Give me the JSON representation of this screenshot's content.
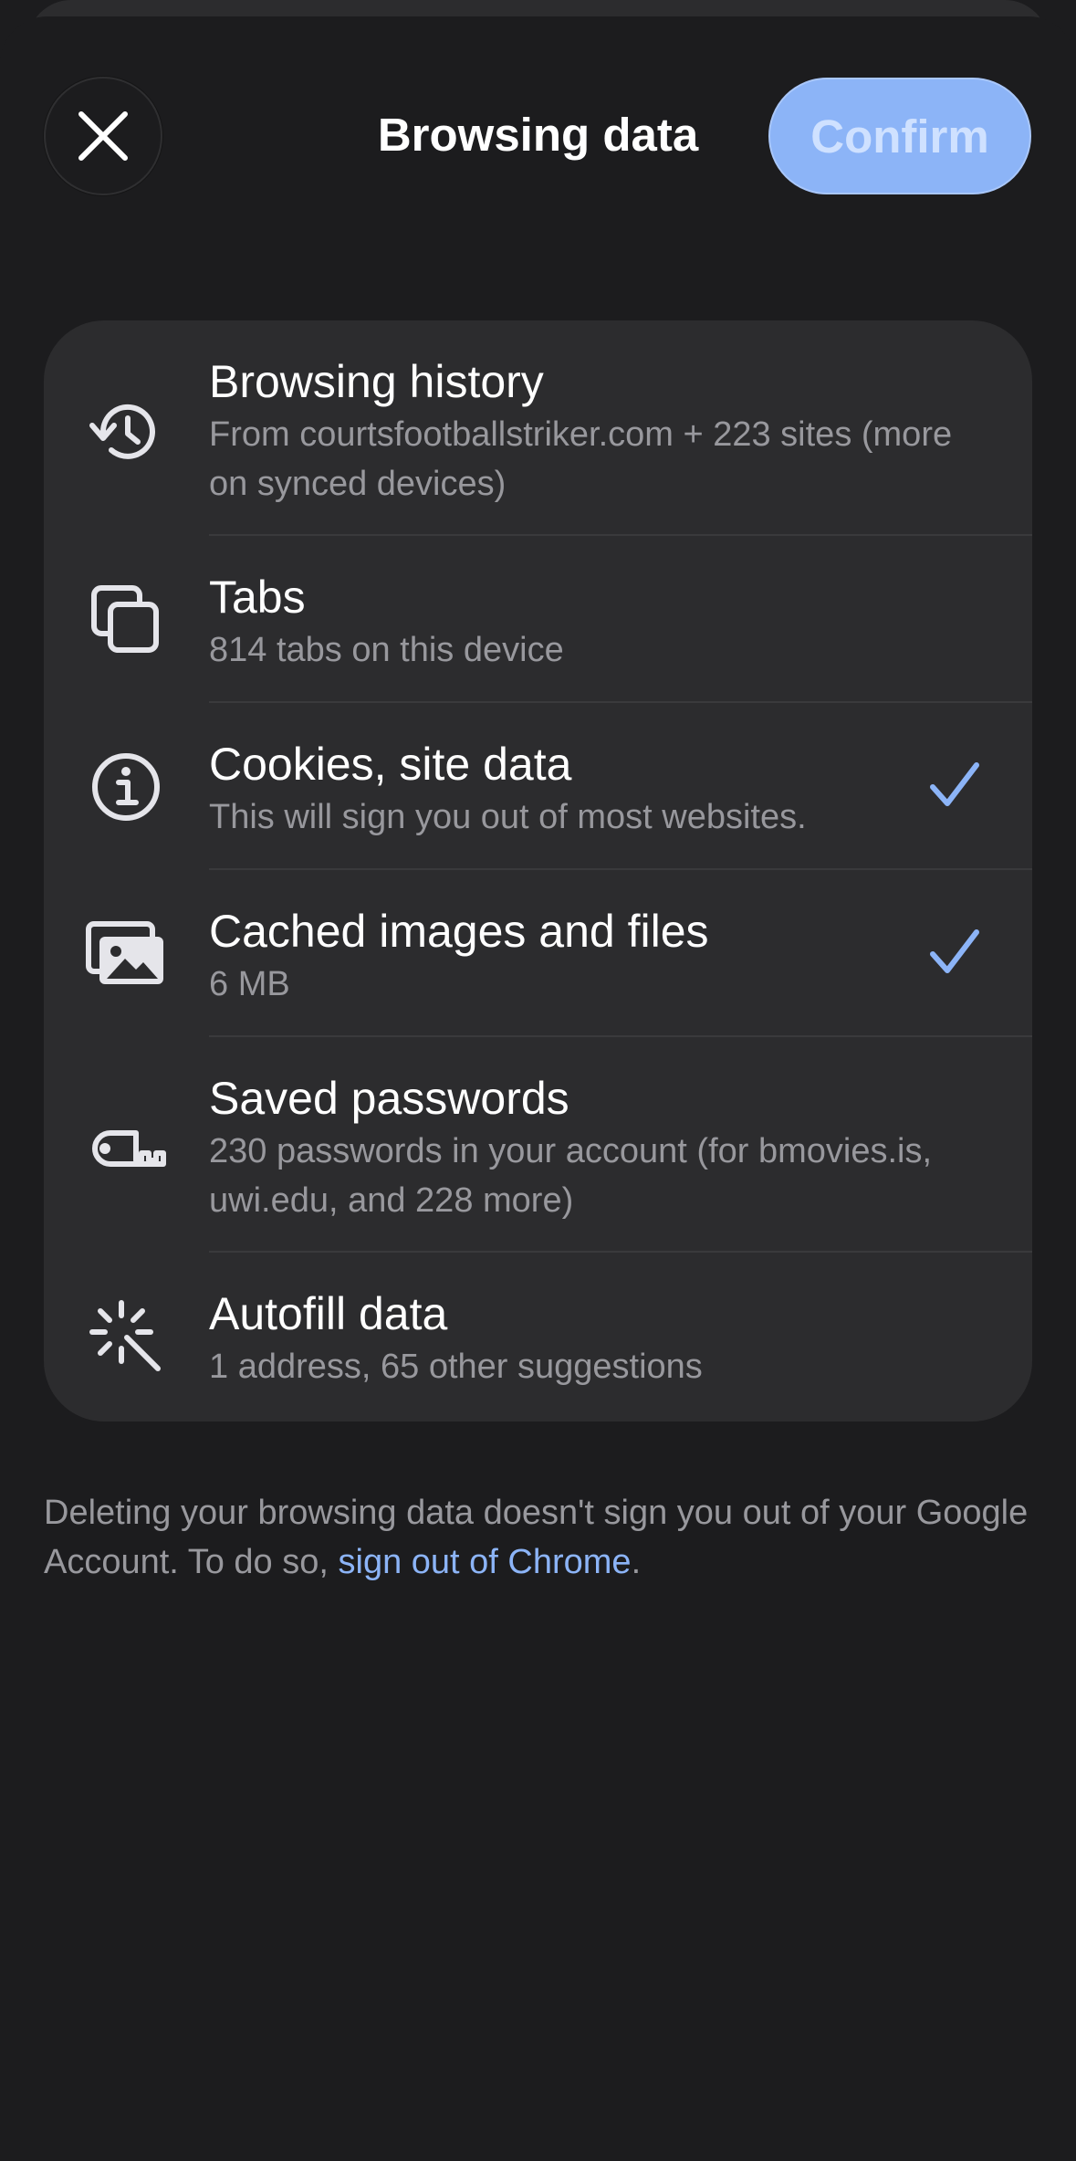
{
  "header": {
    "title": "Browsing data",
    "confirm_label": "Confirm"
  },
  "items": [
    {
      "label": "Browsing history",
      "sub": "From courtsfootballstriker.com + 223 sites (more on synced devices)",
      "icon": "history-icon",
      "checked": false
    },
    {
      "label": "Tabs",
      "sub": "814 tabs on this device",
      "icon": "tabs-icon",
      "checked": false
    },
    {
      "label": "Cookies, site data",
      "sub": "This will sign you out of most websites.",
      "icon": "info-icon",
      "checked": true
    },
    {
      "label": "Cached images and files",
      "sub": "6 MB",
      "icon": "images-icon",
      "checked": true
    },
    {
      "label": "Saved passwords",
      "sub": "230 passwords in your account (for bmovies.is, uwi.edu, and 228 more)",
      "icon": "key-icon",
      "checked": false
    },
    {
      "label": "Autofill data",
      "sub": "1 address, 65 other suggestions",
      "icon": "magic-wand-icon",
      "checked": false
    }
  ],
  "footer": {
    "text_before": "Deleting your browsing data doesn't sign you out of your Google Account. To do so, ",
    "link": "sign out of Chrome",
    "text_after": "."
  },
  "colors": {
    "background": "#1c1c1e",
    "card": "#2c2c2e",
    "accent": "#8cb4f7",
    "secondary_text": "#98989d"
  }
}
